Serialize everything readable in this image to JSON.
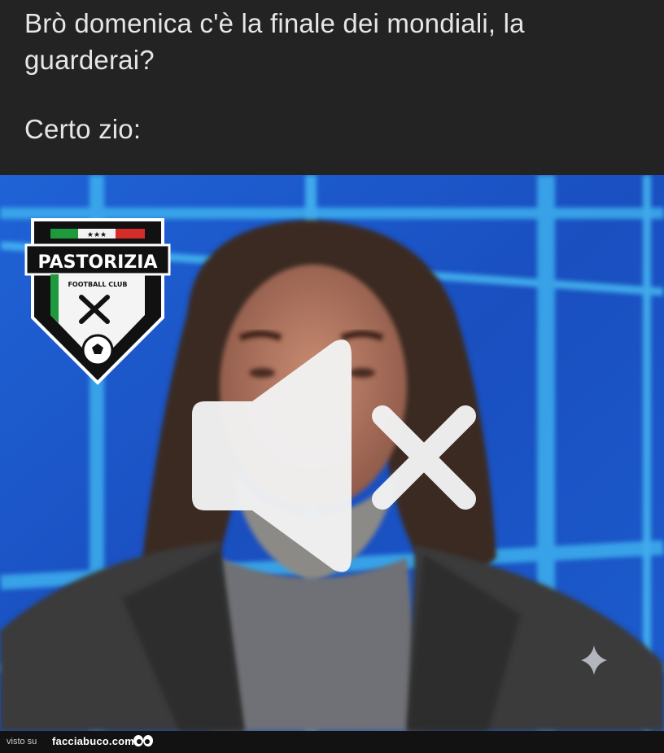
{
  "caption": {
    "line1": "Brò domenica c'è la finale dei mondiali, la",
    "line2": "guarderai?",
    "line3": "Certo zio:"
  },
  "logo": {
    "stars": "★★★",
    "name": "PASTORIZIA",
    "subtitle": "FOOTBALL CLUB"
  },
  "icons": {
    "mute": "speaker-muted-icon",
    "sparkle": "sparkle-icon"
  },
  "footer": {
    "prefix": "visto su",
    "brand": "facciabuco.com"
  },
  "colors": {
    "caption_bg": "#232323",
    "caption_text": "#e6e6e6",
    "studio_blue": "#1a55c4",
    "grid_cyan": "#3fb6f0",
    "flag_green": "#1e9a3c",
    "flag_red": "#d42b2b"
  }
}
